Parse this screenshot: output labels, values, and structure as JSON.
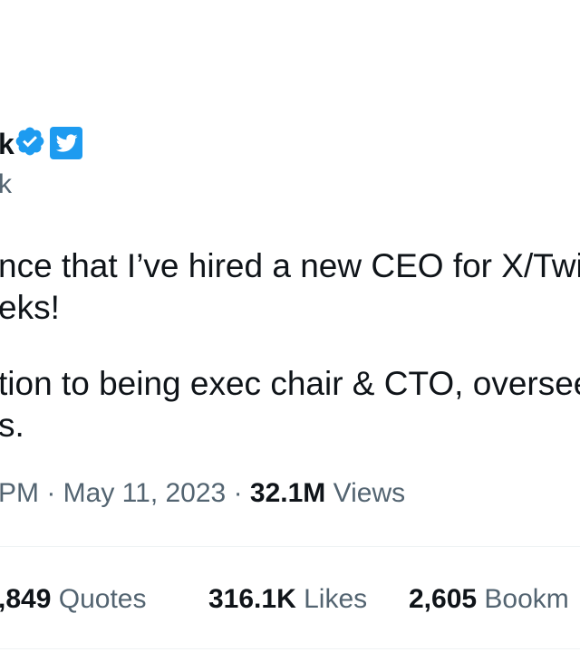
{
  "header": {
    "name_visible": "k",
    "handle_visible": "k",
    "badges": {
      "verified_icon": "verified-badge-icon",
      "verified_color": "#1d9bf0",
      "platform_icon": "twitter-bird-icon",
      "platform_color": "#1d9bf0"
    }
  },
  "tweet": {
    "lines": [
      "nce that I’ve hired a new CEO for X/Twi",
      "eks!",
      "tion to being exec chair & CTO, oversee",
      "s."
    ]
  },
  "meta": {
    "time_fragment": "PM",
    "separator": " · ",
    "date": "May 11, 2023",
    "views_count": "32.1M",
    "views_label": "Views"
  },
  "stats": {
    "quotes_count": ",849",
    "quotes_label": "Quotes",
    "likes_count": "316.1K",
    "likes_label": "Likes",
    "bookmarks_count": "2,605",
    "bookmarks_label": "Bookm"
  }
}
